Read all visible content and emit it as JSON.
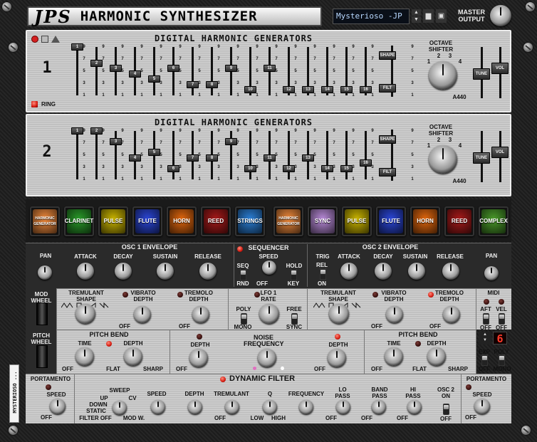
{
  "header": {
    "logo": "JPS",
    "title": "HARMONIC SYNTHESIZER",
    "patch_name": "Mysterioso -JP",
    "master_output": "MASTER OUTPUT"
  },
  "side_label": "MYSTERIOSO ...",
  "generators": [
    {
      "title": "DIGITAL HARMONIC GENERATORS",
      "number": "1",
      "ring": "RING",
      "harmonic_levels": [
        9,
        6,
        5,
        4,
        3,
        5,
        2,
        2,
        5,
        1,
        5,
        1,
        1,
        1,
        1,
        1
      ],
      "shape": "SHAPE",
      "filt": "FILT",
      "octave_title": "OCTAVE SHIFTER",
      "octave_steps": [
        "1",
        "2",
        "3",
        "4"
      ],
      "a440": "A440",
      "tune": "TUNE",
      "vol": "VOL"
    },
    {
      "title": "DIGITAL HARMONIC GENERATORS",
      "number": "2",
      "harmonic_levels": [
        9,
        9,
        7,
        4,
        5,
        2,
        4,
        4,
        7,
        2,
        4,
        2,
        4,
        2,
        2,
        3
      ],
      "shape": "SHAPE",
      "filt": "FILT",
      "octave_title": "OCTAVE SHIFTER",
      "octave_steps": [
        "1",
        "2",
        "3",
        "4"
      ],
      "a440": "A440",
      "tune": "TUNE",
      "vol": "VOL"
    }
  ],
  "tick_labels": [
    "9",
    "7",
    "5",
    "3",
    "1"
  ],
  "presets_left": [
    {
      "label": "HARMONIC GENERATOR",
      "color": "#f08a3c"
    },
    {
      "label": "CLARINET",
      "color": "#2a9a2a"
    },
    {
      "label": "PULSE",
      "color": "#c9b400"
    },
    {
      "label": "FLUTE",
      "color": "#2b46d6"
    },
    {
      "label": "HORN",
      "color": "#e0660e"
    },
    {
      "label": "REED",
      "color": "#a61a1a"
    },
    {
      "label": "STRINGS",
      "color": "#2b7fd6"
    }
  ],
  "presets_right": [
    {
      "label": "HARMONIC GENERATOR",
      "color": "#f08a3c"
    },
    {
      "label": "SYNC",
      "color": "#b88ad8"
    },
    {
      "label": "PULSE",
      "color": "#c9b400"
    },
    {
      "label": "FLUTE",
      "color": "#2b46d6"
    },
    {
      "label": "HORN",
      "color": "#e0660e"
    },
    {
      "label": "REED",
      "color": "#a61a1a"
    },
    {
      "label": "COMPLEX",
      "color": "#4a9a2a"
    }
  ],
  "env1": {
    "pan": "PAN",
    "title": "OSC 1 ENVELOPE",
    "attack": "ATTACK",
    "decay": "DECAY",
    "sustain": "SUSTAIN",
    "release": "RELEASE"
  },
  "seq": {
    "title": "SEQUENCER",
    "speed": "SPEED",
    "seq": "SEQ",
    "rnd": "RND",
    "off": "OFF",
    "hold": "HOLD",
    "key": "KEY"
  },
  "env2": {
    "title": "OSC 2 ENVELOPE",
    "trig": "TRIG",
    "rel": "REL",
    "on": "ON",
    "attack": "ATTACK",
    "decay": "DECAY",
    "sustain": "SUSTAIN",
    "release": "RELEASE",
    "pan": "PAN"
  },
  "row3": {
    "mod_wheel": "MOD WHEEL",
    "trem_shape": "TREMULANT SHAPE",
    "vib_depth": "VIBRATO DEPTH",
    "trem_depth": "TREMOLO DEPTH",
    "off": "OFF",
    "lfo_title": "LFO 1 RATE",
    "poly": "POLY",
    "mono": "MONO",
    "free": "FREE",
    "sync": "SYNC",
    "trem_shape2": "TREMULANT SHAPE",
    "vib_depth2": "VIBRATO DEPTH",
    "trem_depth2": "TREMOLO DEPTH",
    "midi": "MIDI",
    "aft": "AFT",
    "vel": "VEL"
  },
  "row4": {
    "pitch_wheel": "PITCH WHEEL",
    "pb": "PITCH BEND",
    "time": "TIME",
    "depth": "DEPTH",
    "flat": "FLAT",
    "sharp": "SHARP",
    "off": "OFF",
    "noise": "NOISE FREQUENCY",
    "pb2": "PITCH BEND",
    "voices": "6",
    "exp": "EXP",
    "poly": "POLY",
    "mono": "MONO"
  },
  "row5": {
    "portamento": "PORTAMENTO",
    "speed": "SPEED",
    "off": "OFF",
    "filter_title": "DYNAMIC FILTER",
    "sweep": "SWEEP",
    "up": "UP",
    "down": "DOWN",
    "static": "STATIC",
    "cv": "CV",
    "filter_off": "FILTER OFF",
    "mod_w": "MOD W.",
    "f_speed": "SPEED",
    "f_depth": "DEPTH",
    "tremulant": "TREMULANT",
    "q": "Q",
    "low": "LOW",
    "high": "HIGH",
    "frequency": "FREQUENCY",
    "lo_pass": "LO PASS",
    "band_pass": "BAND PASS",
    "hi_pass": "HI PASS",
    "osc2": "OSC 2 ON",
    "portamento2": "PORTAMENTO",
    "speed2": "SPEED"
  }
}
